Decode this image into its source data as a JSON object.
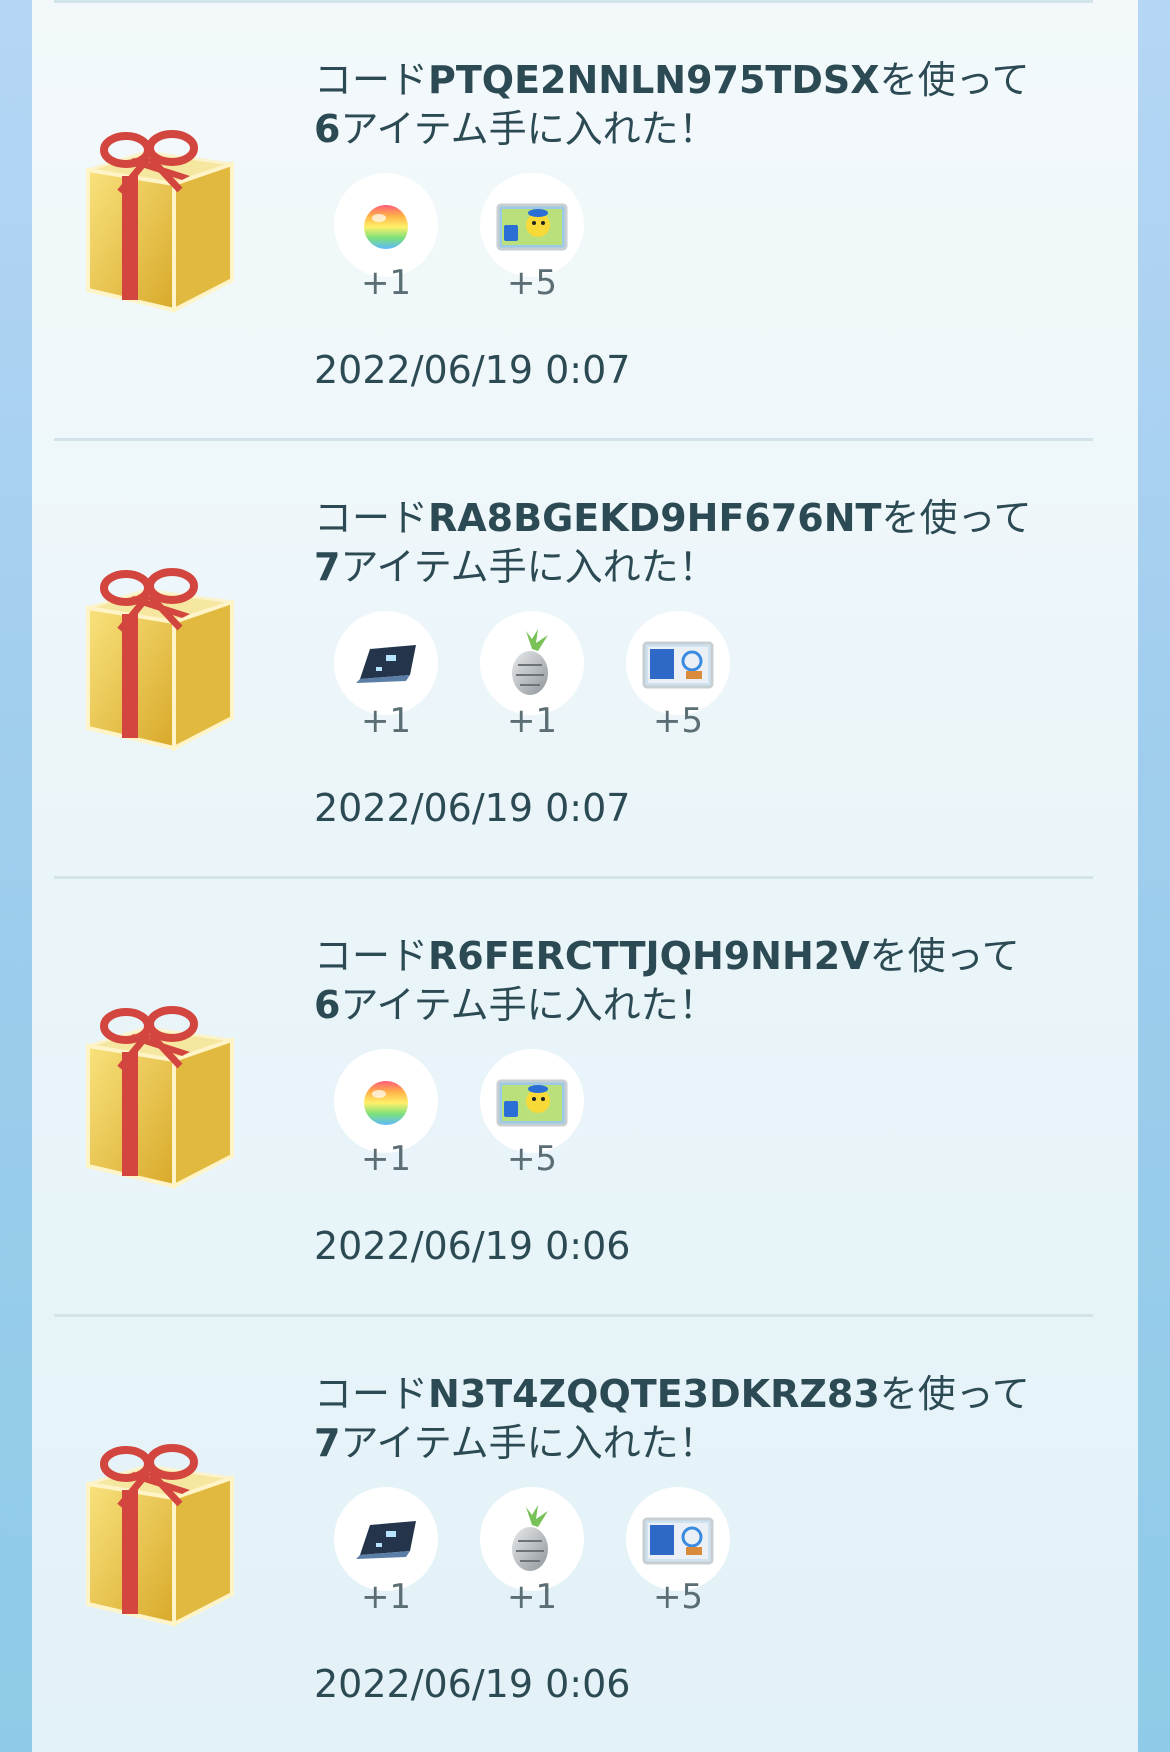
{
  "entries": [
    {
      "prefix": "コード",
      "code": "PTQE2NNLN975TDSX",
      "mid": "を使って",
      "count": "6",
      "suffix": "アイテム手に入れた！",
      "items": [
        {
          "icon": "rainbow-candy-icon",
          "qty": "+1"
        },
        {
          "icon": "pikachu-sticker-icon",
          "qty": "+5"
        }
      ],
      "date": "2022/06/19 0:07"
    },
    {
      "prefix": "コード",
      "code": "RA8BGEKD9HF676NT",
      "mid": "を使って",
      "count": "7",
      "suffix": "アイテム手に入れた！",
      "items": [
        {
          "icon": "map-scroll-icon",
          "qty": "+1"
        },
        {
          "icon": "silver-pinap-berry-icon",
          "qty": "+1"
        },
        {
          "icon": "blue-sticker-icon",
          "qty": "+5"
        }
      ],
      "date": "2022/06/19 0:07"
    },
    {
      "prefix": "コード",
      "code": "R6FERCTTJQH9NH2V",
      "mid": "を使って",
      "count": "6",
      "suffix": "アイテム手に入れた！",
      "items": [
        {
          "icon": "rainbow-candy-icon",
          "qty": "+1"
        },
        {
          "icon": "pikachu-sticker-icon",
          "qty": "+5"
        }
      ],
      "date": "2022/06/19 0:06"
    },
    {
      "prefix": "コード",
      "code": "N3T4ZQQTE3DKRZ83",
      "mid": "を使って",
      "count": "7",
      "suffix": "アイテム手に入れた！",
      "items": [
        {
          "icon": "map-scroll-icon",
          "qty": "+1"
        },
        {
          "icon": "silver-pinap-berry-icon",
          "qty": "+1"
        },
        {
          "icon": "blue-sticker-icon",
          "qty": "+5"
        }
      ],
      "date": "2022/06/19 0:06"
    }
  ]
}
